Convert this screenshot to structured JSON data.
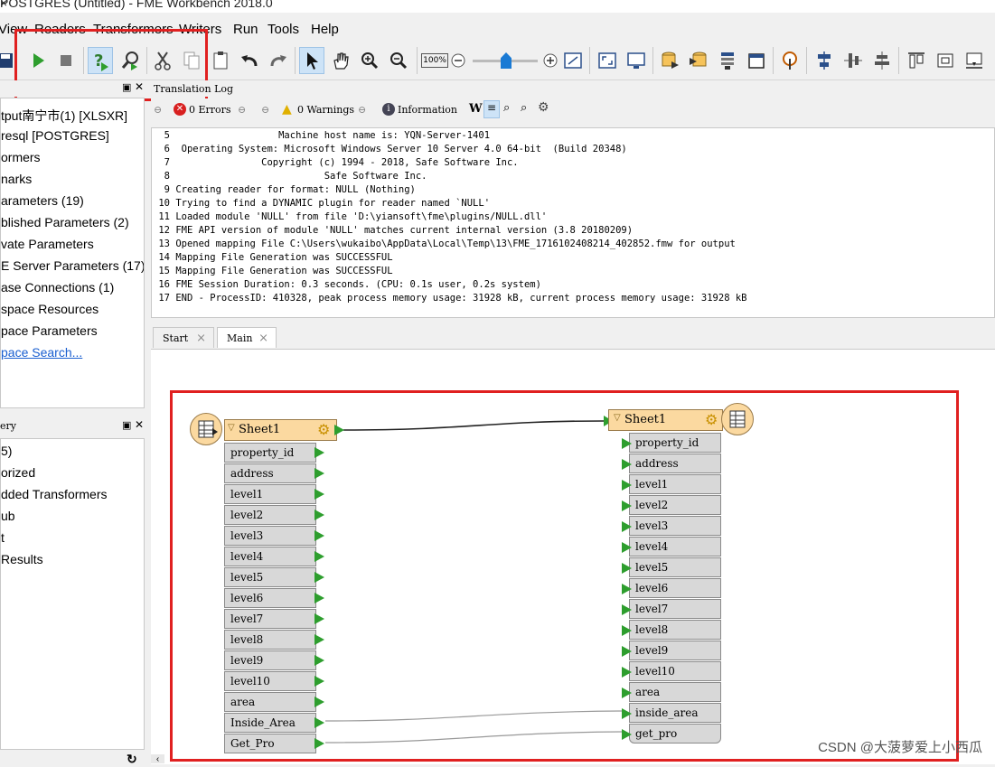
{
  "window": {
    "title": "POSTGRES (Untitled) - FME Workbench 2018.0",
    "close_glyph": "×"
  },
  "menu": {
    "items": [
      "View",
      "Readers",
      "Transformers",
      "Writers",
      "Run",
      "Tools",
      "Help"
    ]
  },
  "toolbar": {
    "zoom_label": "100%"
  },
  "nav_panel": {
    "items": [
      "tput南宁市(1) [XLSXR]",
      "resql [POSTGRES]",
      "ormers",
      "narks",
      "arameters (19)",
      "blished Parameters (2)",
      "vate Parameters",
      "E Server Parameters (17)",
      "ase Connections (1)",
      "space Resources",
      "pace Parameters",
      "pace Search..."
    ]
  },
  "transformer_panel": {
    "title": "ery",
    "items": [
      "5)",
      "orized",
      "dded Transformers",
      "ub",
      "t",
      "Results"
    ]
  },
  "log_panel": {
    "title": "Translation Log",
    "errors": "0 Errors",
    "warnings": "0 Warnings",
    "information": "Information",
    "lines": [
      {
        "n": "5",
        "t": "                  Machine host name is: YQN-Server-1401"
      },
      {
        "n": "6",
        "t": " Operating System: Microsoft Windows Server 10 Server 4.0 64-bit  (Build 20348)"
      },
      {
        "n": "7",
        "t": "               Copyright (c) 1994 - 2018, Safe Software Inc."
      },
      {
        "n": "8",
        "t": "                          Safe Software Inc."
      },
      {
        "n": "9",
        "t": "Creating reader for format: NULL (Nothing)"
      },
      {
        "n": "10",
        "t": "Trying to find a DYNAMIC plugin for reader named `NULL'"
      },
      {
        "n": "11",
        "t": "Loaded module 'NULL' from file 'D:\\yiansoft\\fme\\plugins/NULL.dll'"
      },
      {
        "n": "12",
        "t": "FME API version of module 'NULL' matches current internal version (3.8 20180209)"
      },
      {
        "n": "13",
        "t": "Opened mapping File C:\\Users\\wukaibo\\AppData\\Local\\Temp\\13\\FME_1716102408214_402852.fmw for output"
      },
      {
        "n": "14",
        "t": "Mapping File Generation was SUCCESSFUL"
      },
      {
        "n": "15",
        "t": "Mapping File Generation was SUCCESSFUL"
      },
      {
        "n": "16",
        "t": "FME Session Duration: 0.3 seconds. (CPU: 0.1s user, 0.2s system)"
      },
      {
        "n": "17",
        "t": "END - ProcessID: 410328, peak process memory usage: 31928 kB, current process memory usage: 31928 kB"
      }
    ]
  },
  "tabs": [
    {
      "label": "Start"
    },
    {
      "label": "Main"
    }
  ],
  "tab_close_glyph": "×",
  "reader": {
    "name": "Sheet1",
    "attributes": [
      "property_id",
      "address",
      "level1",
      "level2",
      "level3",
      "level4",
      "level5",
      "level6",
      "level7",
      "level8",
      "level9",
      "level10",
      "area",
      "Inside_Area",
      "Get_Pro"
    ]
  },
  "writer": {
    "name": "Sheet1",
    "attributes": [
      "property_id",
      "address",
      "level1",
      "level2",
      "level3",
      "level4",
      "level5",
      "level6",
      "level7",
      "level8",
      "level9",
      "level10",
      "area",
      "inside_area",
      "get_pro"
    ]
  },
  "watermark": "CSDN @大菠萝爱上小西瓜",
  "colors": {
    "highlight_box": "#e02020",
    "port_green": "#2e9e2e",
    "node_orange": "#fbd9a0"
  }
}
